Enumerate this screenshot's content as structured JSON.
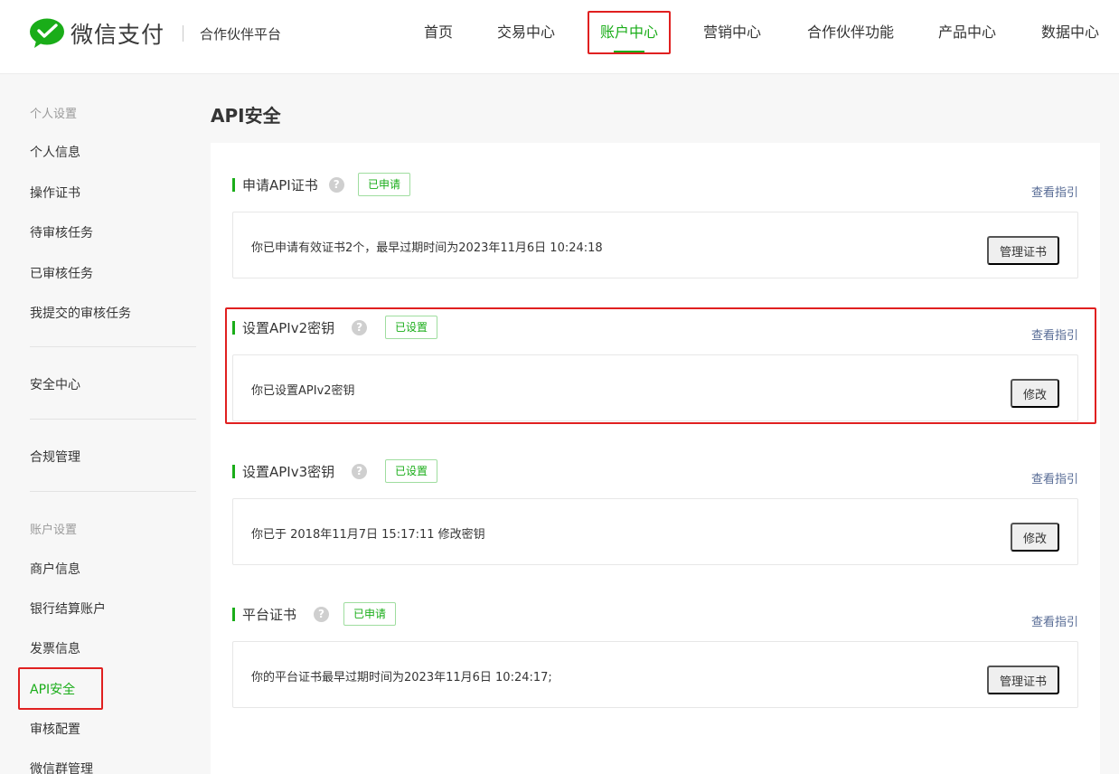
{
  "brand": {
    "name": "微信支付",
    "subtitle": "合作伙伴平台",
    "logo_icon": "wechat-bubble-icon",
    "color": "#1aad19"
  },
  "nav": {
    "items": [
      {
        "label": "首页",
        "active": false
      },
      {
        "label": "交易中心",
        "active": false
      },
      {
        "label": "账户中心",
        "active": true
      },
      {
        "label": "营销中心",
        "active": false
      },
      {
        "label": "合作伙伴功能",
        "active": false
      },
      {
        "label": "产品中心",
        "active": false
      },
      {
        "label": "数据中心",
        "active": false
      }
    ]
  },
  "sidebar": {
    "group_personal": "个人设置",
    "personal_items": [
      "个人信息",
      "操作证书",
      "待审核任务",
      "已审核任务",
      "我提交的审核任务"
    ],
    "security": "安全中心",
    "compliance": "合规管理",
    "group_account": "账户设置",
    "account_items": [
      "商户信息",
      "银行结算账户",
      "发票信息",
      "API安全",
      "审核配置",
      "微信群管理"
    ],
    "active_item": "API安全"
  },
  "page": {
    "title": "API安全"
  },
  "sections": [
    {
      "title": "申请API证书",
      "badge": "已申请",
      "guide": "查看指引",
      "text": "你已申请有效证书2个，最早过期时间为2023年11月6日 10:24:18",
      "button": "管理证书"
    },
    {
      "title": "设置APIv2密钥",
      "badge": "已设置",
      "guide": "查看指引",
      "text": "你已设置APIv2密钥",
      "button": "修改"
    },
    {
      "title": "设置APIv3密钥",
      "badge": "已设置",
      "guide": "查看指引",
      "text": "你已于 2018年11月7日 15:17:11 修改密钥",
      "button": "修改"
    },
    {
      "title": "平台证书",
      "badge": "已申请",
      "guide": "查看指引",
      "text": "你的平台证书最早过期时间为2023年11月6日 10:24:17;",
      "button": "管理证书"
    }
  ],
  "icons": {
    "help": "question-circle-icon"
  },
  "help_glyph": "?"
}
